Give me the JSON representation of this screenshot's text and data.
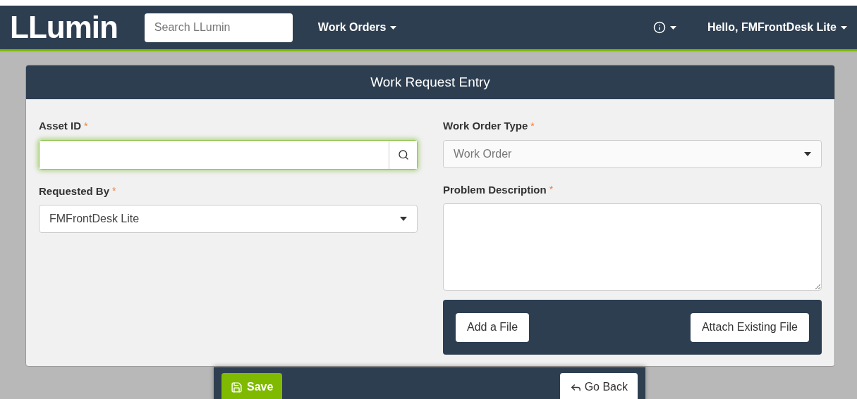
{
  "navbar": {
    "logo": "LLumin",
    "search": {
      "placeholder": "Search LLumin"
    },
    "menu": "Work Orders",
    "user_menu": "Hello, FMFrontDesk Lite"
  },
  "form": {
    "title": "Work Request Entry",
    "left_fields": [
      {
        "kind": "lookup",
        "label": "Asset ID",
        "required_mark": "*",
        "focused": true
      },
      {
        "kind": "select",
        "label": "Requested By",
        "required_mark": "*",
        "value": "FMFrontDesk Lite",
        "disabled": false
      }
    ],
    "right_fields": [
      {
        "kind": "select",
        "label": "Work Order Type",
        "required_mark": "*",
        "value": "Work Order",
        "disabled": true
      },
      {
        "kind": "textarea",
        "label": "Problem Description",
        "required_mark": "*"
      }
    ],
    "file_buttons": [
      "Add a File",
      "Attach Existing File"
    ]
  },
  "footer": {
    "save": "Save",
    "back": "Go Back"
  }
}
